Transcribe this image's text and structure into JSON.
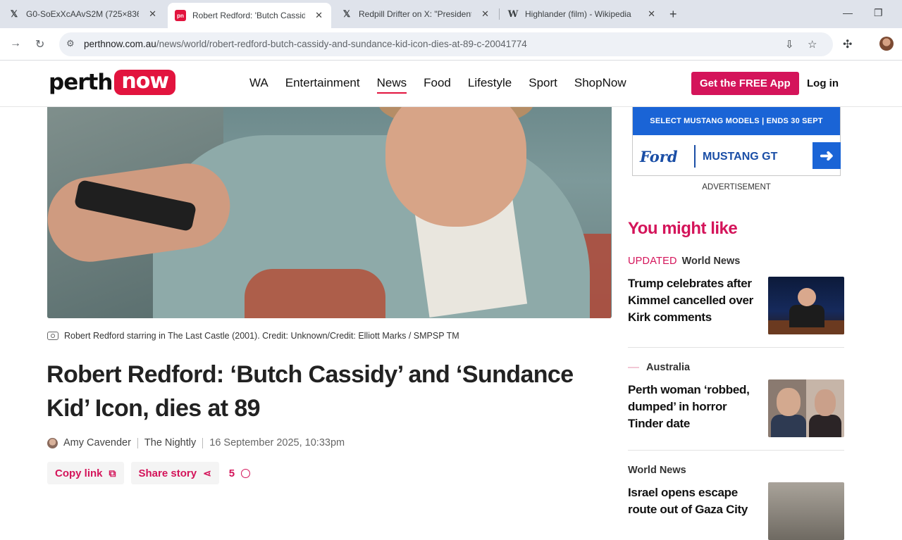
{
  "browser": {
    "tabs": [
      {
        "label": "G0-SoExXcAAvS2M (725×836)",
        "icon": "x-logo-icon"
      },
      {
        "label": "Robert Redford: 'Butch Cassidy",
        "icon": "perthnow-icon",
        "active": true
      },
      {
        "label": "Redpill Drifter on X: \"President",
        "icon": "x-logo-icon"
      },
      {
        "label": "Highlander (film) - Wikipedia",
        "icon": "wikipedia-icon"
      }
    ],
    "url_host": "perthnow.com.au",
    "url_path": "/news/world/robert-redford-butch-cassidy-and-sundance-kid-icon-dies-at-89-c-20041774"
  },
  "site": {
    "logo_perth": "perth",
    "logo_now": "now",
    "nav": [
      "WA",
      "Entertainment",
      "News",
      "Food",
      "Lifestyle",
      "Sport",
      "ShopNow"
    ],
    "active_nav": "News",
    "get_app": "Get the FREE App",
    "login": "Log in"
  },
  "article": {
    "caption": "Robert Redford starring in The Last Castle (2001). Credit: Unknown/Credit: Elliott Marks / SMPSP TM",
    "headline": "Robert Redford: ‘Butch Cassidy’ and ‘Sundance Kid’ Icon, dies at 89",
    "author": "Amy Cavender",
    "publication": "The Nightly",
    "date": "16 September 2025, 10:33pm",
    "copy_link": "Copy link",
    "share_story": "Share story",
    "comment_count": "5"
  },
  "sidebar": {
    "ad": {
      "band": "SELECT MUSTANG MODELS | ENDS 30 SEPT",
      "brand": "Ford",
      "model": "MUSTANG GT",
      "label": "ADVERTISEMENT"
    },
    "heading": "You might like",
    "stories": [
      {
        "updated": "UPDATED",
        "section": "World News",
        "title": "Trump celebrates after Kimmel cancelled over Kirk comments"
      },
      {
        "updated": "",
        "section": "Australia",
        "title": "Perth woman ‘robbed, dumped’ in horror Tinder date"
      },
      {
        "updated": "",
        "section": "World News",
        "title": "Israel opens escape route out of Gaza City"
      }
    ]
  },
  "colors": {
    "brand": "#e2143e",
    "accent": "#d4145a",
    "ford_blue": "#1a64d6"
  }
}
